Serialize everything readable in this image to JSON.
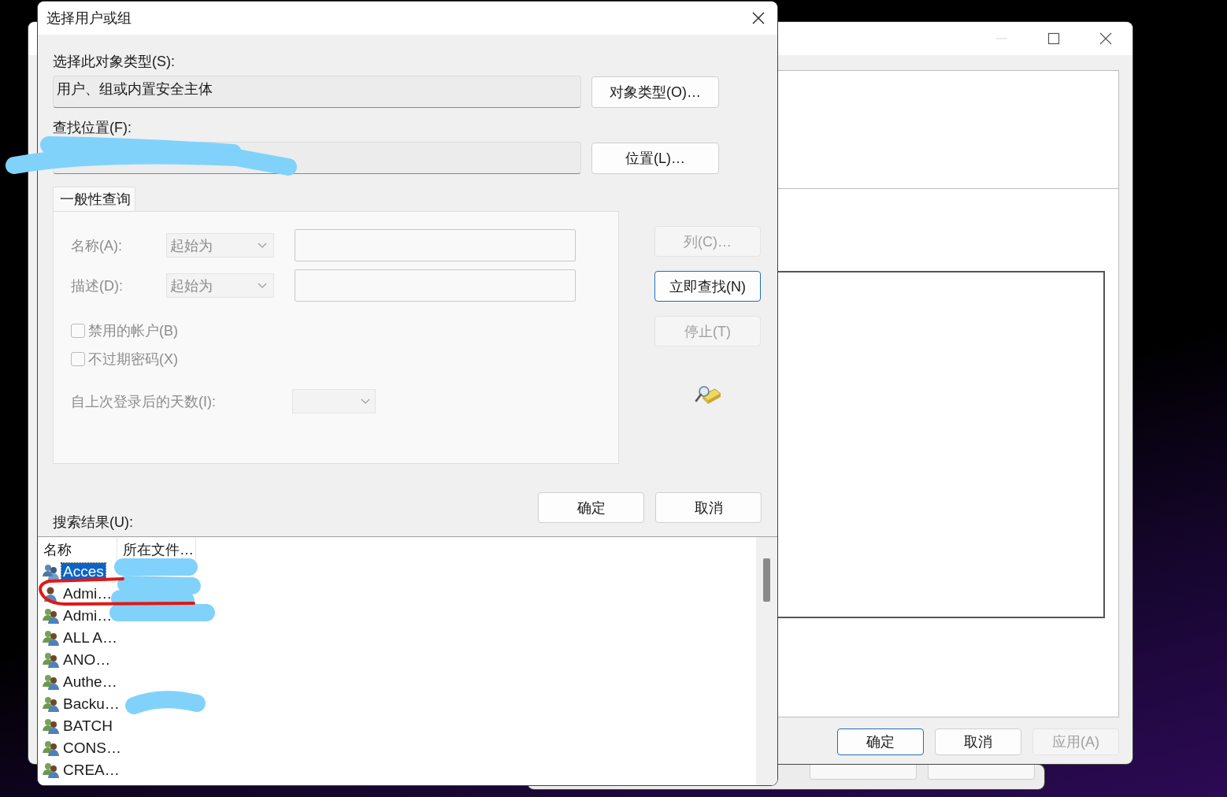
{
  "properties_window": {
    "buttons": [
      {
        "label": "确定",
        "default": true,
        "disabled": false
      },
      {
        "label": "取消",
        "default": false,
        "disabled": false
      },
      {
        "label": "应用(A)",
        "default": false,
        "disabled": true
      }
    ]
  },
  "dialog": {
    "title": "选择用户或组",
    "object_type": {
      "label": "选择此对象类型(S):",
      "value": "用户、组或内置安全主体",
      "button": "对象类型(O)…"
    },
    "location": {
      "label": "查找位置(F):",
      "button": "位置(L)…"
    },
    "tabs": [
      {
        "label": "一般性查询",
        "selected": true
      }
    ],
    "query": {
      "disabled": true,
      "name_label": "名称(A):",
      "name_mode": "起始为",
      "description_label": "描述(D):",
      "description_mode": "起始为",
      "checkboxes": [
        {
          "label": "禁用的帐户(B)",
          "checked": false
        },
        {
          "label": "不过期密码(X)",
          "checked": false
        }
      ],
      "days_label": "自上次登录后的天数(I):"
    },
    "side_buttons": [
      {
        "label": "列(C)…",
        "default": false,
        "disabled": true
      },
      {
        "label": "立即查找(N)",
        "default": true,
        "disabled": false
      },
      {
        "label": "停止(T)",
        "default": false,
        "disabled": true
      }
    ],
    "buttons": [
      {
        "label": "确定",
        "default": false,
        "disabled": false
      },
      {
        "label": "取消",
        "default": false,
        "disabled": false
      }
    ],
    "results": {
      "label": "搜索结果(U):",
      "columns": [
        "名称",
        "所在文件…"
      ],
      "rows": [
        {
          "name": "Acces",
          "kind": "group",
          "selected": true
        },
        {
          "name": "Admi…",
          "kind": "user",
          "selected": false
        },
        {
          "name": "Admi…",
          "kind": "group",
          "selected": false
        },
        {
          "name": "ALL A…",
          "kind": "group",
          "selected": false
        },
        {
          "name": "ANO…",
          "kind": "group",
          "selected": false
        },
        {
          "name": "Authe…",
          "kind": "group",
          "selected": false
        },
        {
          "name": "Backu…",
          "kind": "group",
          "selected": false
        },
        {
          "name": "BATCH",
          "kind": "group",
          "selected": false
        },
        {
          "name": "CONS…",
          "kind": "group",
          "selected": false
        },
        {
          "name": "CREA…",
          "kind": "group",
          "selected": false
        }
      ]
    }
  }
}
